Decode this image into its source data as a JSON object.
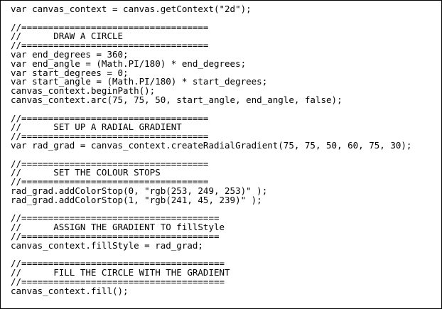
{
  "code": {
    "lines": [
      "var canvas_context = canvas.getContext(\"2d\");",
      "",
      "//===================================",
      "//      DRAW A CIRCLE",
      "//===================================",
      "var end_degrees = 360;",
      "var end_angle = (Math.PI/180) * end_degrees;",
      "var start_degrees = 0;",
      "var start_angle = (Math.PI/180) * start_degrees;",
      "canvas_context.beginPath();",
      "canvas_context.arc(75, 75, 50, start_angle, end_angle, false);",
      "",
      "//===================================",
      "//      SET UP A RADIAL GRADIENT",
      "//===================================",
      "var rad_grad = canvas_context.createRadialGradient(75, 75, 50, 60, 75, 30);",
      "",
      "//===================================",
      "//      SET THE COLOUR STOPS",
      "//===================================",
      "rad_grad.addColorStop(0, \"rgb(253, 249, 253)\" );",
      "rad_grad.addColorStop(1, \"rgb(241, 45, 239)\" );",
      "",
      "//=====================================",
      "//      ASSIGN THE GRADIENT TO fillStyle",
      "//=====================================",
      "canvas_context.fillStyle = rad_grad;",
      "",
      "//======================================",
      "//      FILL THE CIRCLE WITH THE GRADIENT",
      "//======================================",
      "canvas_context.fill();"
    ]
  }
}
